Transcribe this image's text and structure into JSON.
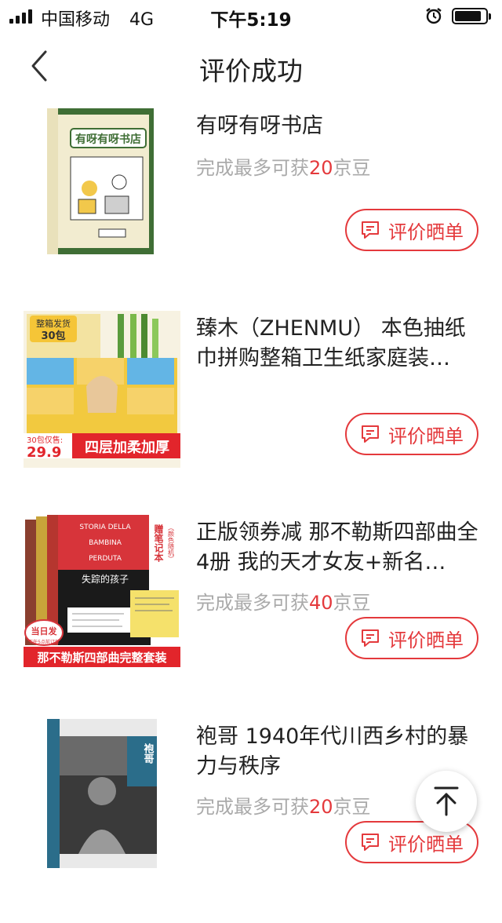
{
  "status_bar": {
    "carrier": "中国移动",
    "network": "4G",
    "time": "下午5:19"
  },
  "nav": {
    "title": "评价成功"
  },
  "items": [
    {
      "title": "有呀有呀书店",
      "reward_prefix": "完成最多可获",
      "reward_num": "20",
      "reward_suffix": "京豆",
      "button_label": "评价晒单",
      "image_text": "有呀有呀书店"
    },
    {
      "title": "臻木（ZHENMU） 本色抽纸巾拼购整箱卫生纸家庭装…",
      "button_label": "评价晒单",
      "image_tag": "整箱发货",
      "image_count": "30包",
      "image_price_label": "30包仅售:",
      "image_price": "29.9",
      "image_banner": "四层加柔加厚"
    },
    {
      "title": "正版领券减 那不勒斯四部曲全4册 我的天才女友+新名…",
      "reward_prefix": "完成最多可获",
      "reward_num": "40",
      "reward_suffix": "京豆",
      "button_label": "评价晒单",
      "image_en1": "STORIA DELLA",
      "image_en2": "BAMBINA",
      "image_en3": "PERDUTA",
      "image_gift": "赠笔记本",
      "image_gift_note": "（颜色随机）",
      "image_cn": "失踪的孩子",
      "image_badge": "当日发",
      "image_badge_sub": "下午5点前订单",
      "image_banner": "那不勒斯四部曲完整套装"
    },
    {
      "title": "袍哥 1940年代川西乡村的暴力与秩序",
      "reward_prefix": "完成最多可获",
      "reward_num": "20",
      "reward_suffix": "京豆",
      "button_label": "评价晒单",
      "image_text": "袍哥"
    }
  ]
}
